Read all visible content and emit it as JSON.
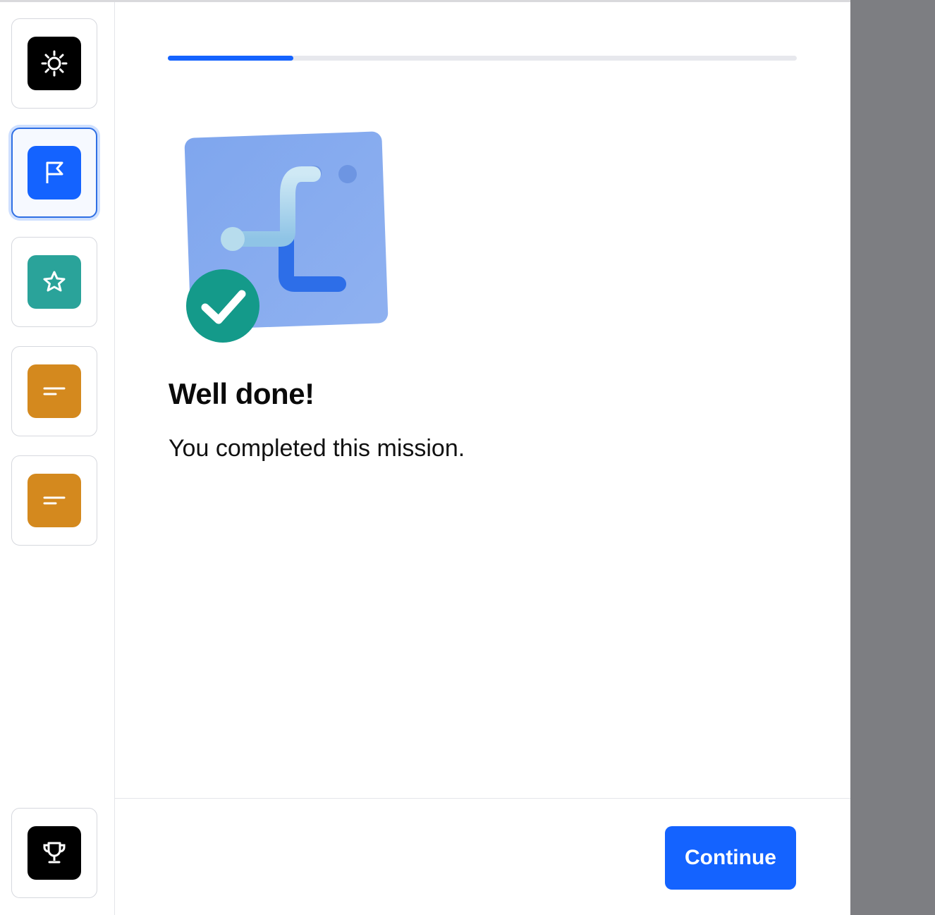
{
  "progress": {
    "fraction": 0.2
  },
  "sidebar": {
    "items": [
      {
        "name": "sidebar-item-settings",
        "icon": "gear-icon",
        "color": "#000000",
        "active": false
      },
      {
        "name": "sidebar-item-mission",
        "icon": "flag-icon",
        "color": "#1463ff",
        "active": true
      },
      {
        "name": "sidebar-item-star",
        "icon": "star-icon",
        "color": "#2aa39a",
        "active": false
      },
      {
        "name": "sidebar-item-task-1",
        "icon": "lines-icon",
        "color": "#d4891e",
        "active": false
      },
      {
        "name": "sidebar-item-task-2",
        "icon": "lines-icon",
        "color": "#d4891e",
        "active": false
      }
    ],
    "bottom_item": {
      "name": "sidebar-item-trophy",
      "icon": "trophy-icon",
      "color": "#000000"
    }
  },
  "main": {
    "title": "Well done!",
    "subtitle": "You completed this mission.",
    "illustration_icon": "mission-complete-illustration",
    "badge_icon": "checkmark-icon"
  },
  "footer": {
    "continue_label": "Continue",
    "continue_color": "#1463ff"
  }
}
